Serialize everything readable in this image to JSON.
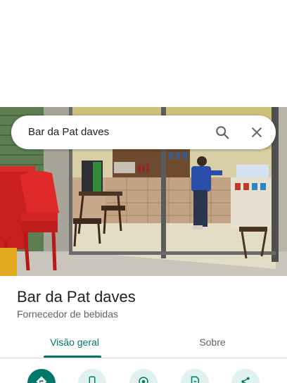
{
  "search": {
    "query": "Bar da Pat daves",
    "search_icon": "search-icon",
    "clear_icon": "close-icon"
  },
  "place": {
    "name": "Bar da Pat daves",
    "category": "Fornecedor de bebidas"
  },
  "tabs": [
    {
      "label": "Visão geral",
      "active": true
    },
    {
      "label": "Sobre",
      "active": false
    }
  ],
  "actions": [
    {
      "icon": "directions-icon",
      "primary": true
    },
    {
      "icon": "phone-icon",
      "primary": false
    },
    {
      "icon": "start-navigation-icon",
      "primary": false
    },
    {
      "icon": "save-icon",
      "primary": false
    },
    {
      "icon": "share-icon",
      "primary": false
    }
  ],
  "colors": {
    "accent": "#00796b",
    "action_bg": "#e0f2ef",
    "text_secondary": "#5f6368"
  }
}
